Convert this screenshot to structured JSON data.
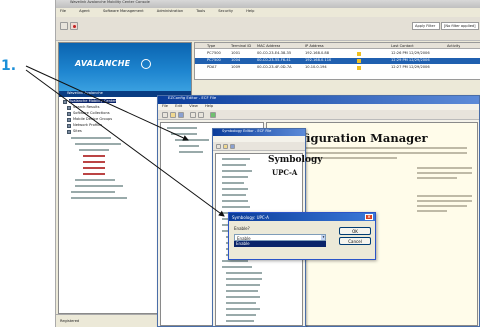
{
  "step_label": "1.",
  "main_window": {
    "title": "Wavelink Avalanche Mobility Center Console",
    "menu": [
      "File",
      "Agent",
      "Software Management",
      "Administration",
      "Tools",
      "Security",
      "Help"
    ],
    "search_label": "Apply Filter",
    "filter_text": "[No filter applied]"
  },
  "banner": {
    "brand": "AVALANCHE"
  },
  "tree": {
    "header": "Wavelink Avalanche",
    "items": [
      "Wavelink Avalanche",
      "Avalanche Mobility Center",
      "Search Results",
      "Software Collections",
      "Mobile Device Groups",
      "Network Profiles",
      "Sites"
    ]
  },
  "grid": {
    "columns": [
      "",
      "Type",
      "Terminal ID",
      "MAC Address",
      "IP Address",
      "",
      "",
      "Last Contact",
      "Activity"
    ],
    "rows": [
      {
        "type": "PC7500",
        "terminal_id": "1001",
        "mac": "00-C0-23-E4-38-35",
        "ip": "192.168.0.88",
        "last_contact": "12:26 PM 12/29/2006"
      },
      {
        "type": "PC7500",
        "terminal_id": "1004",
        "mac": "00-C0-23-55-F6-41",
        "ip": "192.168.0.110",
        "last_contact": "12:29 PM 12/29/2006"
      },
      {
        "type": "PDA7",
        "terminal_id": "1009",
        "mac": "00-C0-23-4F-0D-7A",
        "ip": "10.10.0.194",
        "last_contact": "12:27 PM 12/29/2006"
      }
    ]
  },
  "config_window": {
    "title": "EZConfig Editor - ECF File",
    "menu": [
      "File",
      "Edit",
      "View",
      "Help"
    ],
    "heading": "Configuration Manager"
  },
  "symbology_window": {
    "title": "Symbology Editor - ECF File",
    "heading": "Symbology",
    "subheading": "UPC-A"
  },
  "dialog": {
    "title": "Symbology: UPC-A",
    "enable_label": "Enable?",
    "select_value": "Enable",
    "list_value": "Enable",
    "ok_label": "OK",
    "cancel_label": "Cancel"
  },
  "status_bar": {
    "text": "Registered"
  }
}
